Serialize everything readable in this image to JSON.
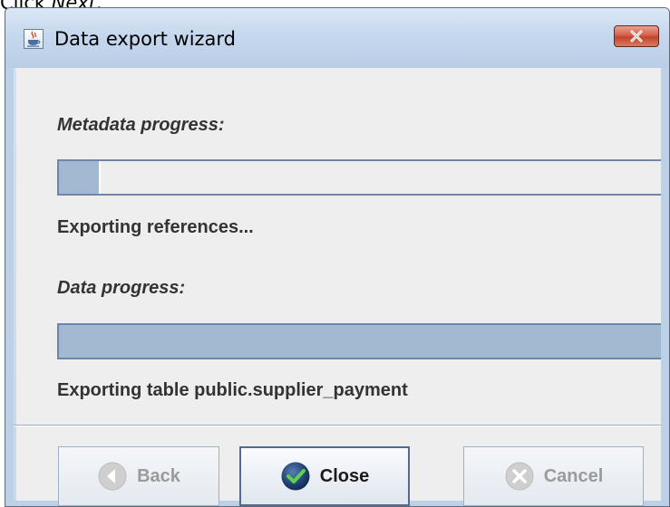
{
  "caption": {
    "prefix": "Click ",
    "emphasis": "Next",
    "suffix": "."
  },
  "window": {
    "title": "Data export wizard"
  },
  "metadata": {
    "label": "Metadata progress:",
    "progress_fraction": 0.07,
    "status": "Exporting references..."
  },
  "data": {
    "label": "Data progress:",
    "progress_fraction": 1.0,
    "status": "Exporting table public.supplier_payment"
  },
  "buttons": {
    "back": {
      "label": "Back",
      "enabled": false
    },
    "close": {
      "label": "Close",
      "enabled": true
    },
    "cancel": {
      "label": "Cancel",
      "enabled": false
    }
  },
  "icons": {
    "window_icon": "java-coffee-icon",
    "close_window": "close-x-icon",
    "back": "back-arrow-icon",
    "close": "checkmark-icon",
    "cancel": "cancel-x-icon"
  },
  "colors": {
    "progress_fill": "#a3b8d1",
    "window_frame": "#bcd0e8",
    "close_button": "#c4442c"
  }
}
